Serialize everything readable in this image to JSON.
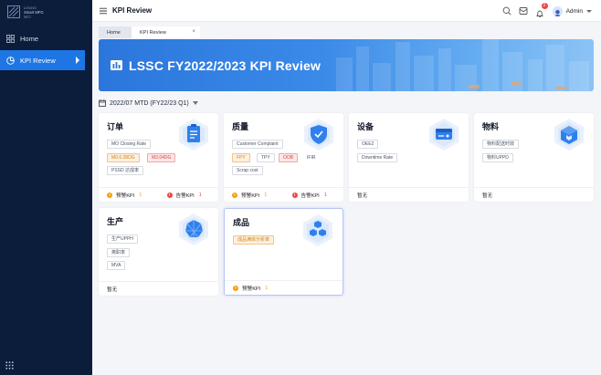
{
  "brand": {
    "line1": "Lenovo",
    "line2": "Smart MFG",
    "line3": "MCI"
  },
  "sidebar": {
    "items": [
      {
        "label": "Home"
      },
      {
        "label": "KPI Review"
      }
    ]
  },
  "header": {
    "title": "KPI Review",
    "notification_count": "2",
    "user": "Admin"
  },
  "tabs": [
    {
      "label": "Home"
    },
    {
      "label": "KPI Review"
    }
  ],
  "banner": {
    "title": "LSSC FY2022/2023 KPI Review"
  },
  "date_selector": {
    "value": "2022/07 MTD (FY22/23 Q1)"
  },
  "cards": [
    {
      "title": "订单",
      "chips": [
        "MO Closing Rate",
        "M0.0.28DG",
        "M3.04DG",
        "PSSD 达成率"
      ],
      "footer": {
        "warn_label": "预警KPI",
        "warn_count": "1",
        "alarm_label": "告警KPI",
        "alarm_count": "1"
      }
    },
    {
      "title": "质量",
      "chips": [
        "Customer Complaint",
        "FPY",
        "TPY",
        "OOB",
        "IFIR",
        "Scrap cost"
      ],
      "footer": {
        "warn_label": "预警KPI",
        "warn_count": "1",
        "alarm_label": "告警KPI",
        "alarm_count": "1"
      }
    },
    {
      "title": "设备",
      "chips": [
        "OEE2",
        "Downtime Rate"
      ],
      "footer": {
        "none_label": "暂无"
      }
    },
    {
      "title": "物料",
      "chips": [
        "物料配送时效",
        "物料UPPD"
      ],
      "footer": {
        "none_label": "暂无"
      }
    },
    {
      "title": "生产",
      "chips": [
        "生产UPPH",
        "离职率",
        "MVA"
      ],
      "footer": {
        "none_label": "暂无"
      }
    },
    {
      "title": "成品",
      "chips": [
        "成品满库分析率"
      ],
      "footer": {
        "warn_label": "预警KPI",
        "warn_count": "1"
      }
    }
  ],
  "colors": {
    "sidebar": "#0b1d3a",
    "accent": "#1d76e4",
    "warn": "#f59e0b",
    "alarm": "#ef4444"
  }
}
